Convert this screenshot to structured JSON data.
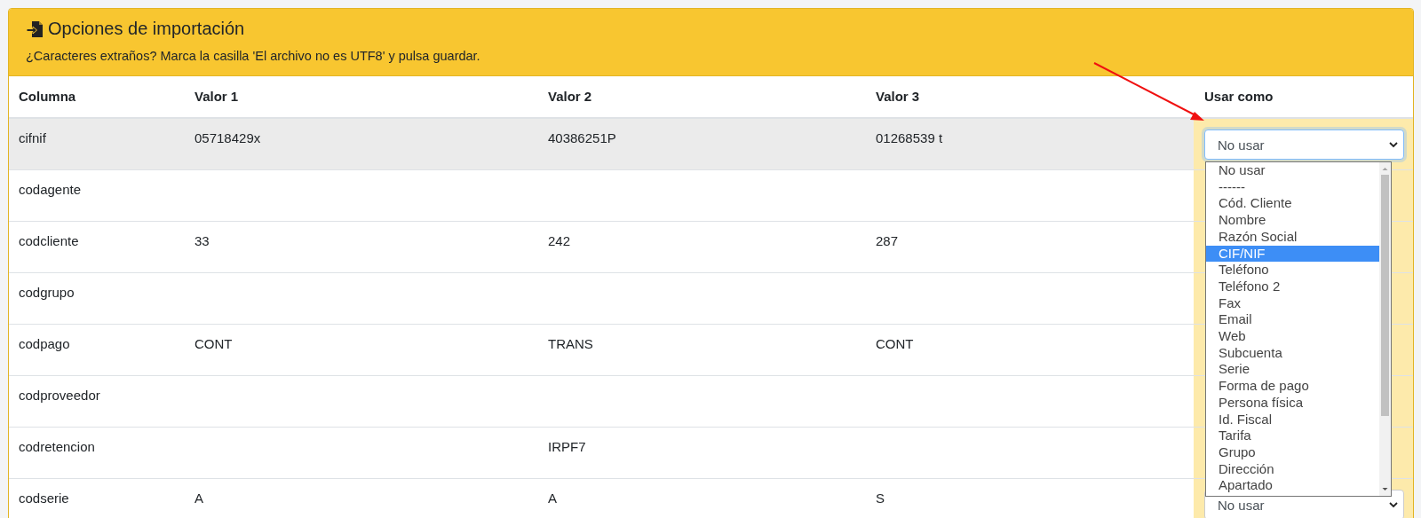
{
  "card": {
    "title": "Opciones de importación",
    "hint": "¿Caracteres extraños? Marca la casilla 'El archivo no es UTF8' y pulsa guardar."
  },
  "table": {
    "columns": [
      "Columna",
      "Valor 1",
      "Valor 2",
      "Valor 3",
      "Usar como"
    ],
    "rows": [
      {
        "cells": [
          "cifnif",
          "05718429x",
          "40386251P",
          "01268539 t"
        ],
        "usar_como": "No usar",
        "selected": true
      },
      {
        "cells": [
          "codagente",
          "",
          "",
          ""
        ],
        "selected": false
      },
      {
        "cells": [
          "codcliente",
          "33",
          "242",
          "287"
        ],
        "selected": false
      },
      {
        "cells": [
          "codgrupo",
          "",
          "",
          ""
        ],
        "selected": false
      },
      {
        "cells": [
          "codpago",
          "CONT",
          "TRANS",
          "CONT"
        ],
        "selected": false
      },
      {
        "cells": [
          "codproveedor",
          "",
          "",
          ""
        ],
        "selected": false
      },
      {
        "cells": [
          "codretencion",
          "",
          "IRPF7",
          ""
        ],
        "selected": false
      },
      {
        "cells": [
          "codserie",
          "A",
          "A",
          "S"
        ],
        "usar_como": "No usar",
        "selected": false
      }
    ]
  },
  "dropdown": {
    "options": [
      {
        "label": "No usar",
        "selected": false
      },
      {
        "label": "------",
        "selected": false
      },
      {
        "label": "Cód. Cliente",
        "selected": false
      },
      {
        "label": "Nombre",
        "selected": false
      },
      {
        "label": "Razón Social",
        "selected": false
      },
      {
        "label": "CIF/NIF",
        "selected": true
      },
      {
        "label": "Teléfono",
        "selected": false
      },
      {
        "label": "Teléfono 2",
        "selected": false
      },
      {
        "label": "Fax",
        "selected": false
      },
      {
        "label": "Email",
        "selected": false
      },
      {
        "label": "Web",
        "selected": false
      },
      {
        "label": "Subcuenta",
        "selected": false
      },
      {
        "label": "Serie",
        "selected": false
      },
      {
        "label": "Forma de pago",
        "selected": false
      },
      {
        "label": "Persona física",
        "selected": false
      },
      {
        "label": "Id. Fiscal",
        "selected": false
      },
      {
        "label": "Tarifa",
        "selected": false
      },
      {
        "label": "Grupo",
        "selected": false
      },
      {
        "label": "Dirección",
        "selected": false
      },
      {
        "label": "Apartado",
        "selected": false
      }
    ]
  }
}
